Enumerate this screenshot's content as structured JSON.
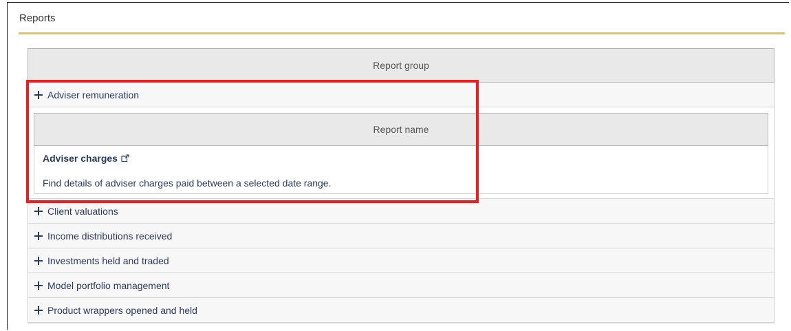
{
  "page": {
    "title": "Reports"
  },
  "table": {
    "group_header": "Report group",
    "groups": [
      {
        "label": "Adviser remuneration",
        "expanded": true
      },
      {
        "label": "Client valuations",
        "expanded": false
      },
      {
        "label": "Income distributions received",
        "expanded": false
      },
      {
        "label": "Investments held and traded",
        "expanded": false
      },
      {
        "label": "Model portfolio management",
        "expanded": false
      },
      {
        "label": "Product wrappers opened and held",
        "expanded": false
      }
    ]
  },
  "expanded": {
    "name_header": "Report name",
    "report_name": "Adviser charges",
    "report_icon": "external-link-icon",
    "report_description": "Find details of adviser charges paid between a selected date range."
  },
  "colors": {
    "accent_rule": "#e3c54a",
    "highlight": "#ee1c1c",
    "link_text": "#2b3b5c"
  }
}
